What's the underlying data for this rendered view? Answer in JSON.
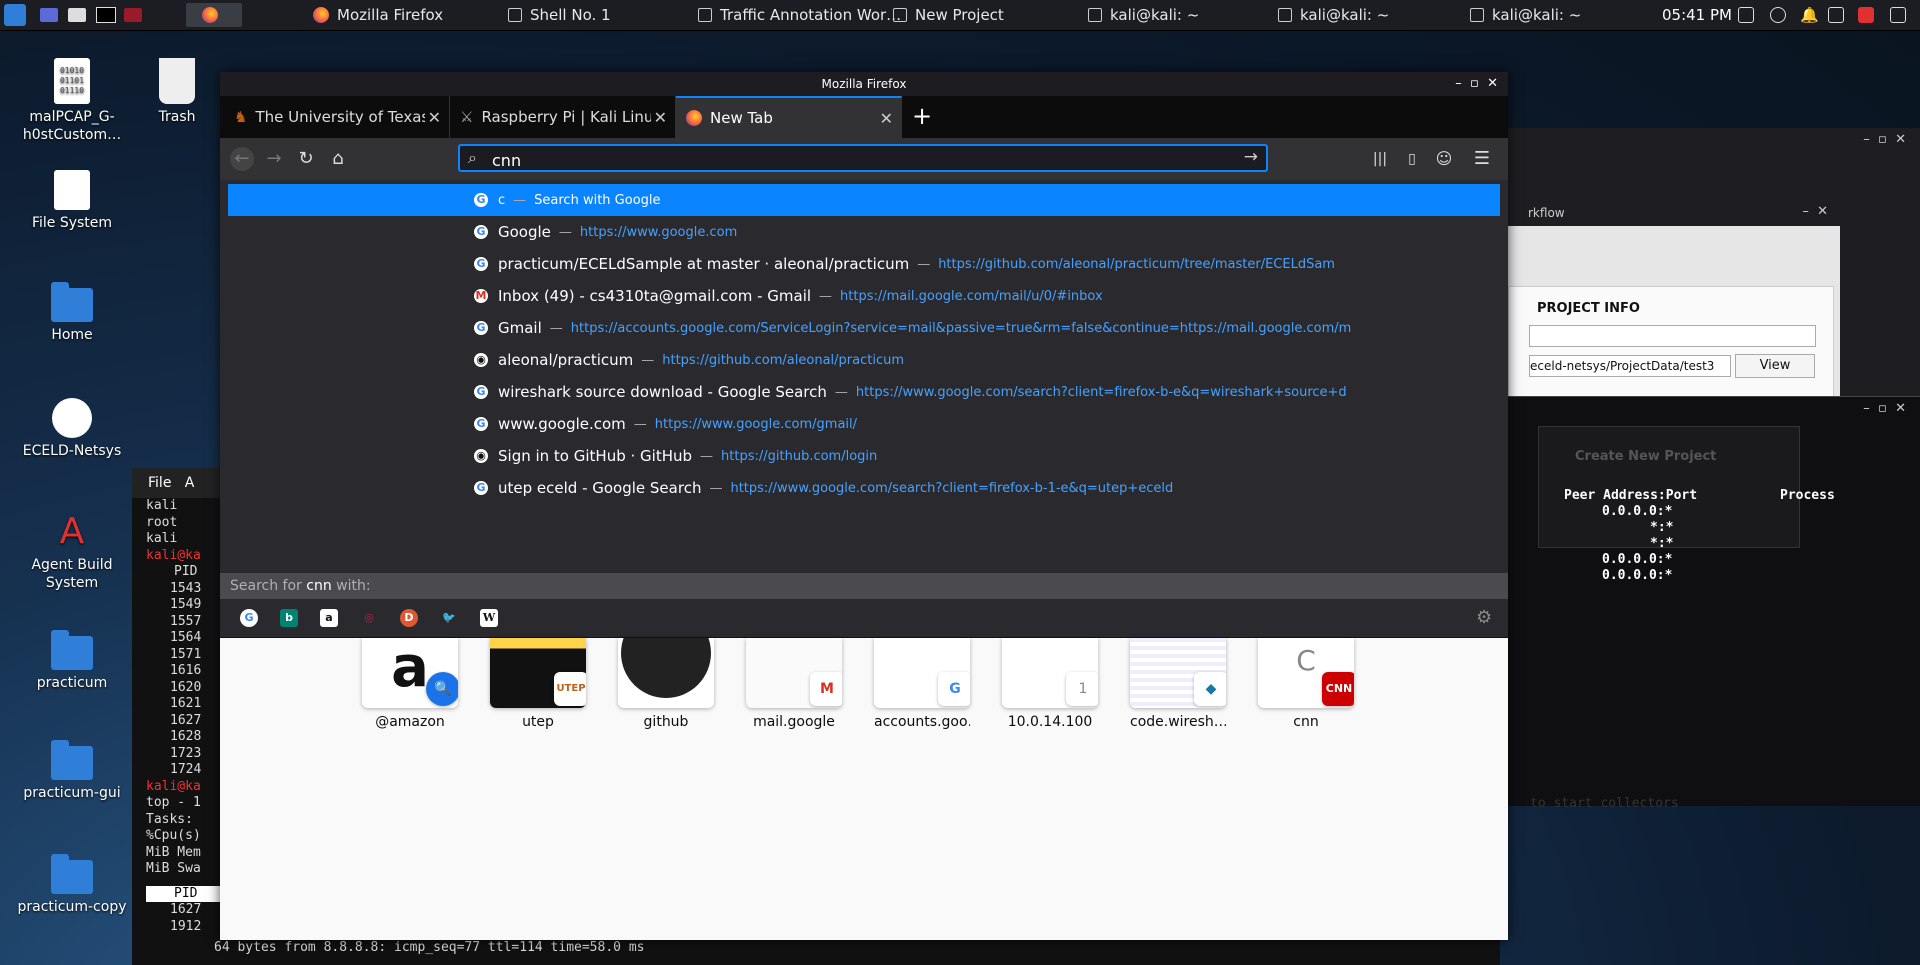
{
  "panel": {
    "tasks": [
      "Mozilla Firefox",
      "Shell No. 1",
      "Traffic Annotation Wor…",
      "New Project",
      "kali@kali: ~",
      "kali@kali: ~",
      "kali@kali: ~"
    ],
    "clock": "05:41 PM"
  },
  "desktop": {
    "icons": [
      "malPCAP_G-h0stCustom…",
      "Trash",
      "File System",
      "Home",
      "ECELD-Netsys",
      "Agent Build System",
      "practicum",
      "practicum-gui",
      "practicum-copy"
    ]
  },
  "background": {
    "terminal_menu": [
      "File",
      "A"
    ],
    "terminal_lines": [
      "kali",
      "root",
      "kali",
      "kali@ka",
      "PID",
      "1543",
      "1549",
      "1557",
      "1564",
      "1571",
      "1616",
      "1620",
      "1621",
      "1627",
      "1628",
      "1723",
      "1724",
      "kali@ka",
      "top - 1",
      "Tasks:",
      "%Cpu(s)",
      "MiB Mem",
      "MiB Swa",
      "PID",
      "1627",
      "1912"
    ],
    "workflow_title": "rkflow",
    "project_info": "PROJECT INFO",
    "project_path": "eceld-netsys/ProjectData/test3",
    "view_button": "View",
    "create_project": "Create New Project",
    "peer_header": "Peer Address:Port",
    "process_header": "Process",
    "peer_rows": [
      "0.0.0.0:*",
      "*:*",
      "*:*",
      "0.0.0.0:*",
      "0.0.0.0:*"
    ],
    "collectors_hint": "to start collectors",
    "bottom_terminal": "64 bytes from 8.8.8.8: icmp_seq=77 ttl=114 time=58.0 ms"
  },
  "firefox": {
    "window_title": "Mozilla Firefox",
    "tabs": [
      {
        "label": "The University of Texas a"
      },
      {
        "label": "Raspberry Pi | Kali Linux I"
      },
      {
        "label": "New Tab"
      }
    ],
    "url_value": "cnn",
    "dropdown": [
      {
        "title": "c",
        "sep": "—",
        "url": "Search with Google",
        "icon": "G"
      },
      {
        "title": "Google",
        "sep": "—",
        "url": "https://www.google.com",
        "icon": "G"
      },
      {
        "title": "practicum/ECELdSample at master · aleonal/practicum",
        "sep": "—",
        "url": "https://github.com/aleonal/practicum/tree/master/ECELdSam",
        "icon": "G"
      },
      {
        "title": "Inbox (49) - cs4310ta@gmail.com - Gmail",
        "sep": "—",
        "url": "https://mail.google.com/mail/u/0/#inbox",
        "icon": "M"
      },
      {
        "title": "Gmail",
        "sep": "—",
        "url": "https://accounts.google.com/ServiceLogin?service=mail&passive=true&rm=false&continue=https://mail.google.com/m",
        "icon": "G"
      },
      {
        "title": "aleonal/practicum",
        "sep": "—",
        "url": "https://github.com/aleonal/practicum",
        "icon": "◉"
      },
      {
        "title": "wireshark source download - Google Search",
        "sep": "—",
        "url": "https://www.google.com/search?client=firefox-b-e&q=wireshark+source+d",
        "icon": "G"
      },
      {
        "title": "www.google.com",
        "sep": "—",
        "url": "https://www.google.com/gmail/",
        "icon": "G"
      },
      {
        "title": "Sign in to GitHub · GitHub",
        "sep": "—",
        "url": "https://github.com/login",
        "icon": "◉"
      },
      {
        "title": "utep eceld - Google Search",
        "sep": "—",
        "url": "https://www.google.com/search?client=firefox-b-1-e&q=utep+eceld",
        "icon": "G"
      }
    ],
    "search_with_prefix": "Search for ",
    "search_with_query": "cnn",
    "search_with_suffix": " with:",
    "engines": [
      "G",
      "b",
      "a",
      "◎",
      "D",
      "🐦",
      "W"
    ],
    "top_sites": [
      {
        "label": "@amazon",
        "badge": "🔍"
      },
      {
        "label": "utep",
        "badge": "UTEP"
      },
      {
        "label": "github",
        "badge": ""
      },
      {
        "label": "mail.google",
        "badge": "M"
      },
      {
        "label": "accounts.goo…",
        "badge": "G"
      },
      {
        "label": "10.0.14.100",
        "badge": "1"
      },
      {
        "label": "code.wiresh…",
        "badge": "◆"
      },
      {
        "label": "cnn",
        "badge": "CNN"
      }
    ],
    "cnn_letter": "C"
  }
}
